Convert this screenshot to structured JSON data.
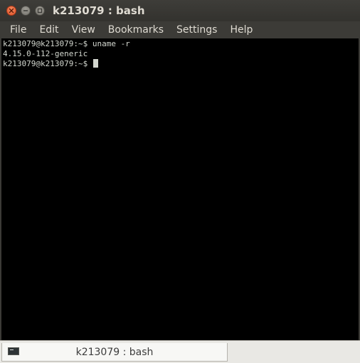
{
  "window": {
    "title": "k213079 : bash",
    "buttons": {
      "close_icon": "close-icon",
      "minimize_icon": "minimize-icon",
      "maximize_icon": "maximize-icon"
    },
    "colors": {
      "titlebar": "#3c3b37",
      "close_button": "#e0542a",
      "terminal_background": "#000000",
      "terminal_text": "#d3d7cf"
    }
  },
  "menubar": {
    "items": [
      "File",
      "Edit",
      "View",
      "Bookmarks",
      "Settings",
      "Help"
    ]
  },
  "terminal": {
    "lines": [
      "k213079@k213079:~$ uname -r",
      "4.15.0-112-generic"
    ],
    "prompt": "k213079@k213079:~$ "
  },
  "tabs": [
    {
      "label": "k213079 : bash",
      "icon": "terminal-icon"
    }
  ]
}
